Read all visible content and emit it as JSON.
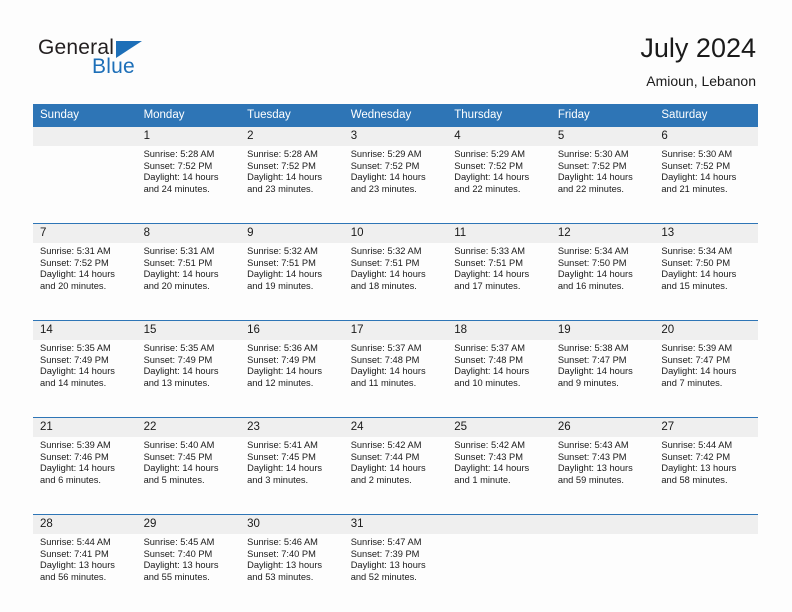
{
  "brand": {
    "word_one": "General",
    "word_two": "Blue",
    "triangle_icon": "triangle-icon"
  },
  "header": {
    "title": "July 2024",
    "location": "Amioun, Lebanon"
  },
  "colors": {
    "header_blue": "#2E75B6",
    "date_row_gray": "#EFEFEF",
    "brand_blue": "#1d6fb8",
    "page_background": "#FDFDFD",
    "text": "#1a1a1a"
  },
  "weekday_headers": [
    "Sunday",
    "Monday",
    "Tuesday",
    "Wednesday",
    "Thursday",
    "Friday",
    "Saturday"
  ],
  "weeks": [
    {
      "dates": [
        "",
        "1",
        "2",
        "3",
        "4",
        "5",
        "6"
      ],
      "cells": [
        {
          "lines": []
        },
        {
          "lines": [
            "Sunrise: 5:28 AM",
            "Sunset: 7:52 PM",
            "Daylight: 14 hours",
            "and 24 minutes."
          ]
        },
        {
          "lines": [
            "Sunrise: 5:28 AM",
            "Sunset: 7:52 PM",
            "Daylight: 14 hours",
            "and 23 minutes."
          ]
        },
        {
          "lines": [
            "Sunrise: 5:29 AM",
            "Sunset: 7:52 PM",
            "Daylight: 14 hours",
            "and 23 minutes."
          ]
        },
        {
          "lines": [
            "Sunrise: 5:29 AM",
            "Sunset: 7:52 PM",
            "Daylight: 14 hours",
            "and 22 minutes."
          ]
        },
        {
          "lines": [
            "Sunrise: 5:30 AM",
            "Sunset: 7:52 PM",
            "Daylight: 14 hours",
            "and 22 minutes."
          ]
        },
        {
          "lines": [
            "Sunrise: 5:30 AM",
            "Sunset: 7:52 PM",
            "Daylight: 14 hours",
            "and 21 minutes."
          ]
        }
      ]
    },
    {
      "dates": [
        "7",
        "8",
        "9",
        "10",
        "11",
        "12",
        "13"
      ],
      "cells": [
        {
          "lines": [
            "Sunrise: 5:31 AM",
            "Sunset: 7:52 PM",
            "Daylight: 14 hours",
            "and 20 minutes."
          ]
        },
        {
          "lines": [
            "Sunrise: 5:31 AM",
            "Sunset: 7:51 PM",
            "Daylight: 14 hours",
            "and 20 minutes."
          ]
        },
        {
          "lines": [
            "Sunrise: 5:32 AM",
            "Sunset: 7:51 PM",
            "Daylight: 14 hours",
            "and 19 minutes."
          ]
        },
        {
          "lines": [
            "Sunrise: 5:32 AM",
            "Sunset: 7:51 PM",
            "Daylight: 14 hours",
            "and 18 minutes."
          ]
        },
        {
          "lines": [
            "Sunrise: 5:33 AM",
            "Sunset: 7:51 PM",
            "Daylight: 14 hours",
            "and 17 minutes."
          ]
        },
        {
          "lines": [
            "Sunrise: 5:34 AM",
            "Sunset: 7:50 PM",
            "Daylight: 14 hours",
            "and 16 minutes."
          ]
        },
        {
          "lines": [
            "Sunrise: 5:34 AM",
            "Sunset: 7:50 PM",
            "Daylight: 14 hours",
            "and 15 minutes."
          ]
        }
      ]
    },
    {
      "dates": [
        "14",
        "15",
        "16",
        "17",
        "18",
        "19",
        "20"
      ],
      "cells": [
        {
          "lines": [
            "Sunrise: 5:35 AM",
            "Sunset: 7:49 PM",
            "Daylight: 14 hours",
            "and 14 minutes."
          ]
        },
        {
          "lines": [
            "Sunrise: 5:35 AM",
            "Sunset: 7:49 PM",
            "Daylight: 14 hours",
            "and 13 minutes."
          ]
        },
        {
          "lines": [
            "Sunrise: 5:36 AM",
            "Sunset: 7:49 PM",
            "Daylight: 14 hours",
            "and 12 minutes."
          ]
        },
        {
          "lines": [
            "Sunrise: 5:37 AM",
            "Sunset: 7:48 PM",
            "Daylight: 14 hours",
            "and 11 minutes."
          ]
        },
        {
          "lines": [
            "Sunrise: 5:37 AM",
            "Sunset: 7:48 PM",
            "Daylight: 14 hours",
            "and 10 minutes."
          ]
        },
        {
          "lines": [
            "Sunrise: 5:38 AM",
            "Sunset: 7:47 PM",
            "Daylight: 14 hours",
            "and 9 minutes."
          ]
        },
        {
          "lines": [
            "Sunrise: 5:39 AM",
            "Sunset: 7:47 PM",
            "Daylight: 14 hours",
            "and 7 minutes."
          ]
        }
      ]
    },
    {
      "dates": [
        "21",
        "22",
        "23",
        "24",
        "25",
        "26",
        "27"
      ],
      "cells": [
        {
          "lines": [
            "Sunrise: 5:39 AM",
            "Sunset: 7:46 PM",
            "Daylight: 14 hours",
            "and 6 minutes."
          ]
        },
        {
          "lines": [
            "Sunrise: 5:40 AM",
            "Sunset: 7:45 PM",
            "Daylight: 14 hours",
            "and 5 minutes."
          ]
        },
        {
          "lines": [
            "Sunrise: 5:41 AM",
            "Sunset: 7:45 PM",
            "Daylight: 14 hours",
            "and 3 minutes."
          ]
        },
        {
          "lines": [
            "Sunrise: 5:42 AM",
            "Sunset: 7:44 PM",
            "Daylight: 14 hours",
            "and 2 minutes."
          ]
        },
        {
          "lines": [
            "Sunrise: 5:42 AM",
            "Sunset: 7:43 PM",
            "Daylight: 14 hours",
            "and 1 minute."
          ]
        },
        {
          "lines": [
            "Sunrise: 5:43 AM",
            "Sunset: 7:43 PM",
            "Daylight: 13 hours",
            "and 59 minutes."
          ]
        },
        {
          "lines": [
            "Sunrise: 5:44 AM",
            "Sunset: 7:42 PM",
            "Daylight: 13 hours",
            "and 58 minutes."
          ]
        }
      ]
    },
    {
      "dates": [
        "28",
        "29",
        "30",
        "31",
        "",
        "",
        ""
      ],
      "cells": [
        {
          "lines": [
            "Sunrise: 5:44 AM",
            "Sunset: 7:41 PM",
            "Daylight: 13 hours",
            "and 56 minutes."
          ]
        },
        {
          "lines": [
            "Sunrise: 5:45 AM",
            "Sunset: 7:40 PM",
            "Daylight: 13 hours",
            "and 55 minutes."
          ]
        },
        {
          "lines": [
            "Sunrise: 5:46 AM",
            "Sunset: 7:40 PM",
            "Daylight: 13 hours",
            "and 53 minutes."
          ]
        },
        {
          "lines": [
            "Sunrise: 5:47 AM",
            "Sunset: 7:39 PM",
            "Daylight: 13 hours",
            "and 52 minutes."
          ]
        },
        {
          "lines": []
        },
        {
          "lines": []
        },
        {
          "lines": []
        }
      ]
    }
  ]
}
